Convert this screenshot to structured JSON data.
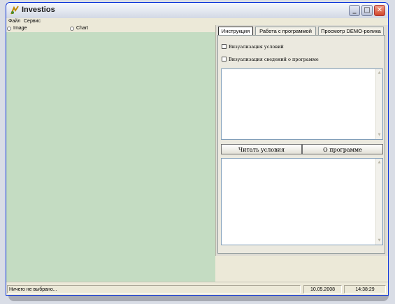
{
  "window": {
    "title": "Investios"
  },
  "menu": [
    {
      "label": "Файл"
    },
    {
      "label": "Сервис"
    }
  ],
  "view_options": [
    {
      "label": "Image",
      "selected": false
    },
    {
      "label": "Chart",
      "selected": false
    }
  ],
  "tabs": [
    {
      "label": "Инструкция",
      "active": true
    },
    {
      "label": "Работа с программой",
      "active": false
    },
    {
      "label": "Просмотр DEMO-ролика",
      "active": false
    }
  ],
  "checkboxes": [
    {
      "label": "Визуализация условий",
      "checked": false
    },
    {
      "label": "Визуализация сведений о программе",
      "checked": false
    }
  ],
  "buttons": {
    "read_terms": "Читать условия",
    "about": "О программе"
  },
  "textboxes": {
    "terms_text": "",
    "about_text": ""
  },
  "status": {
    "message": "Ничего не выбрано...",
    "date": "10.05.2008",
    "time": "14:38:29"
  },
  "colors": {
    "canvas": "#c4dcc2",
    "chrome": "#ece9d8",
    "close_button": "#d1462a"
  },
  "icons": {
    "app": "app-logo-icon",
    "minimize": "minimize-icon",
    "maximize": "maximize-icon",
    "close": "close-icon"
  }
}
